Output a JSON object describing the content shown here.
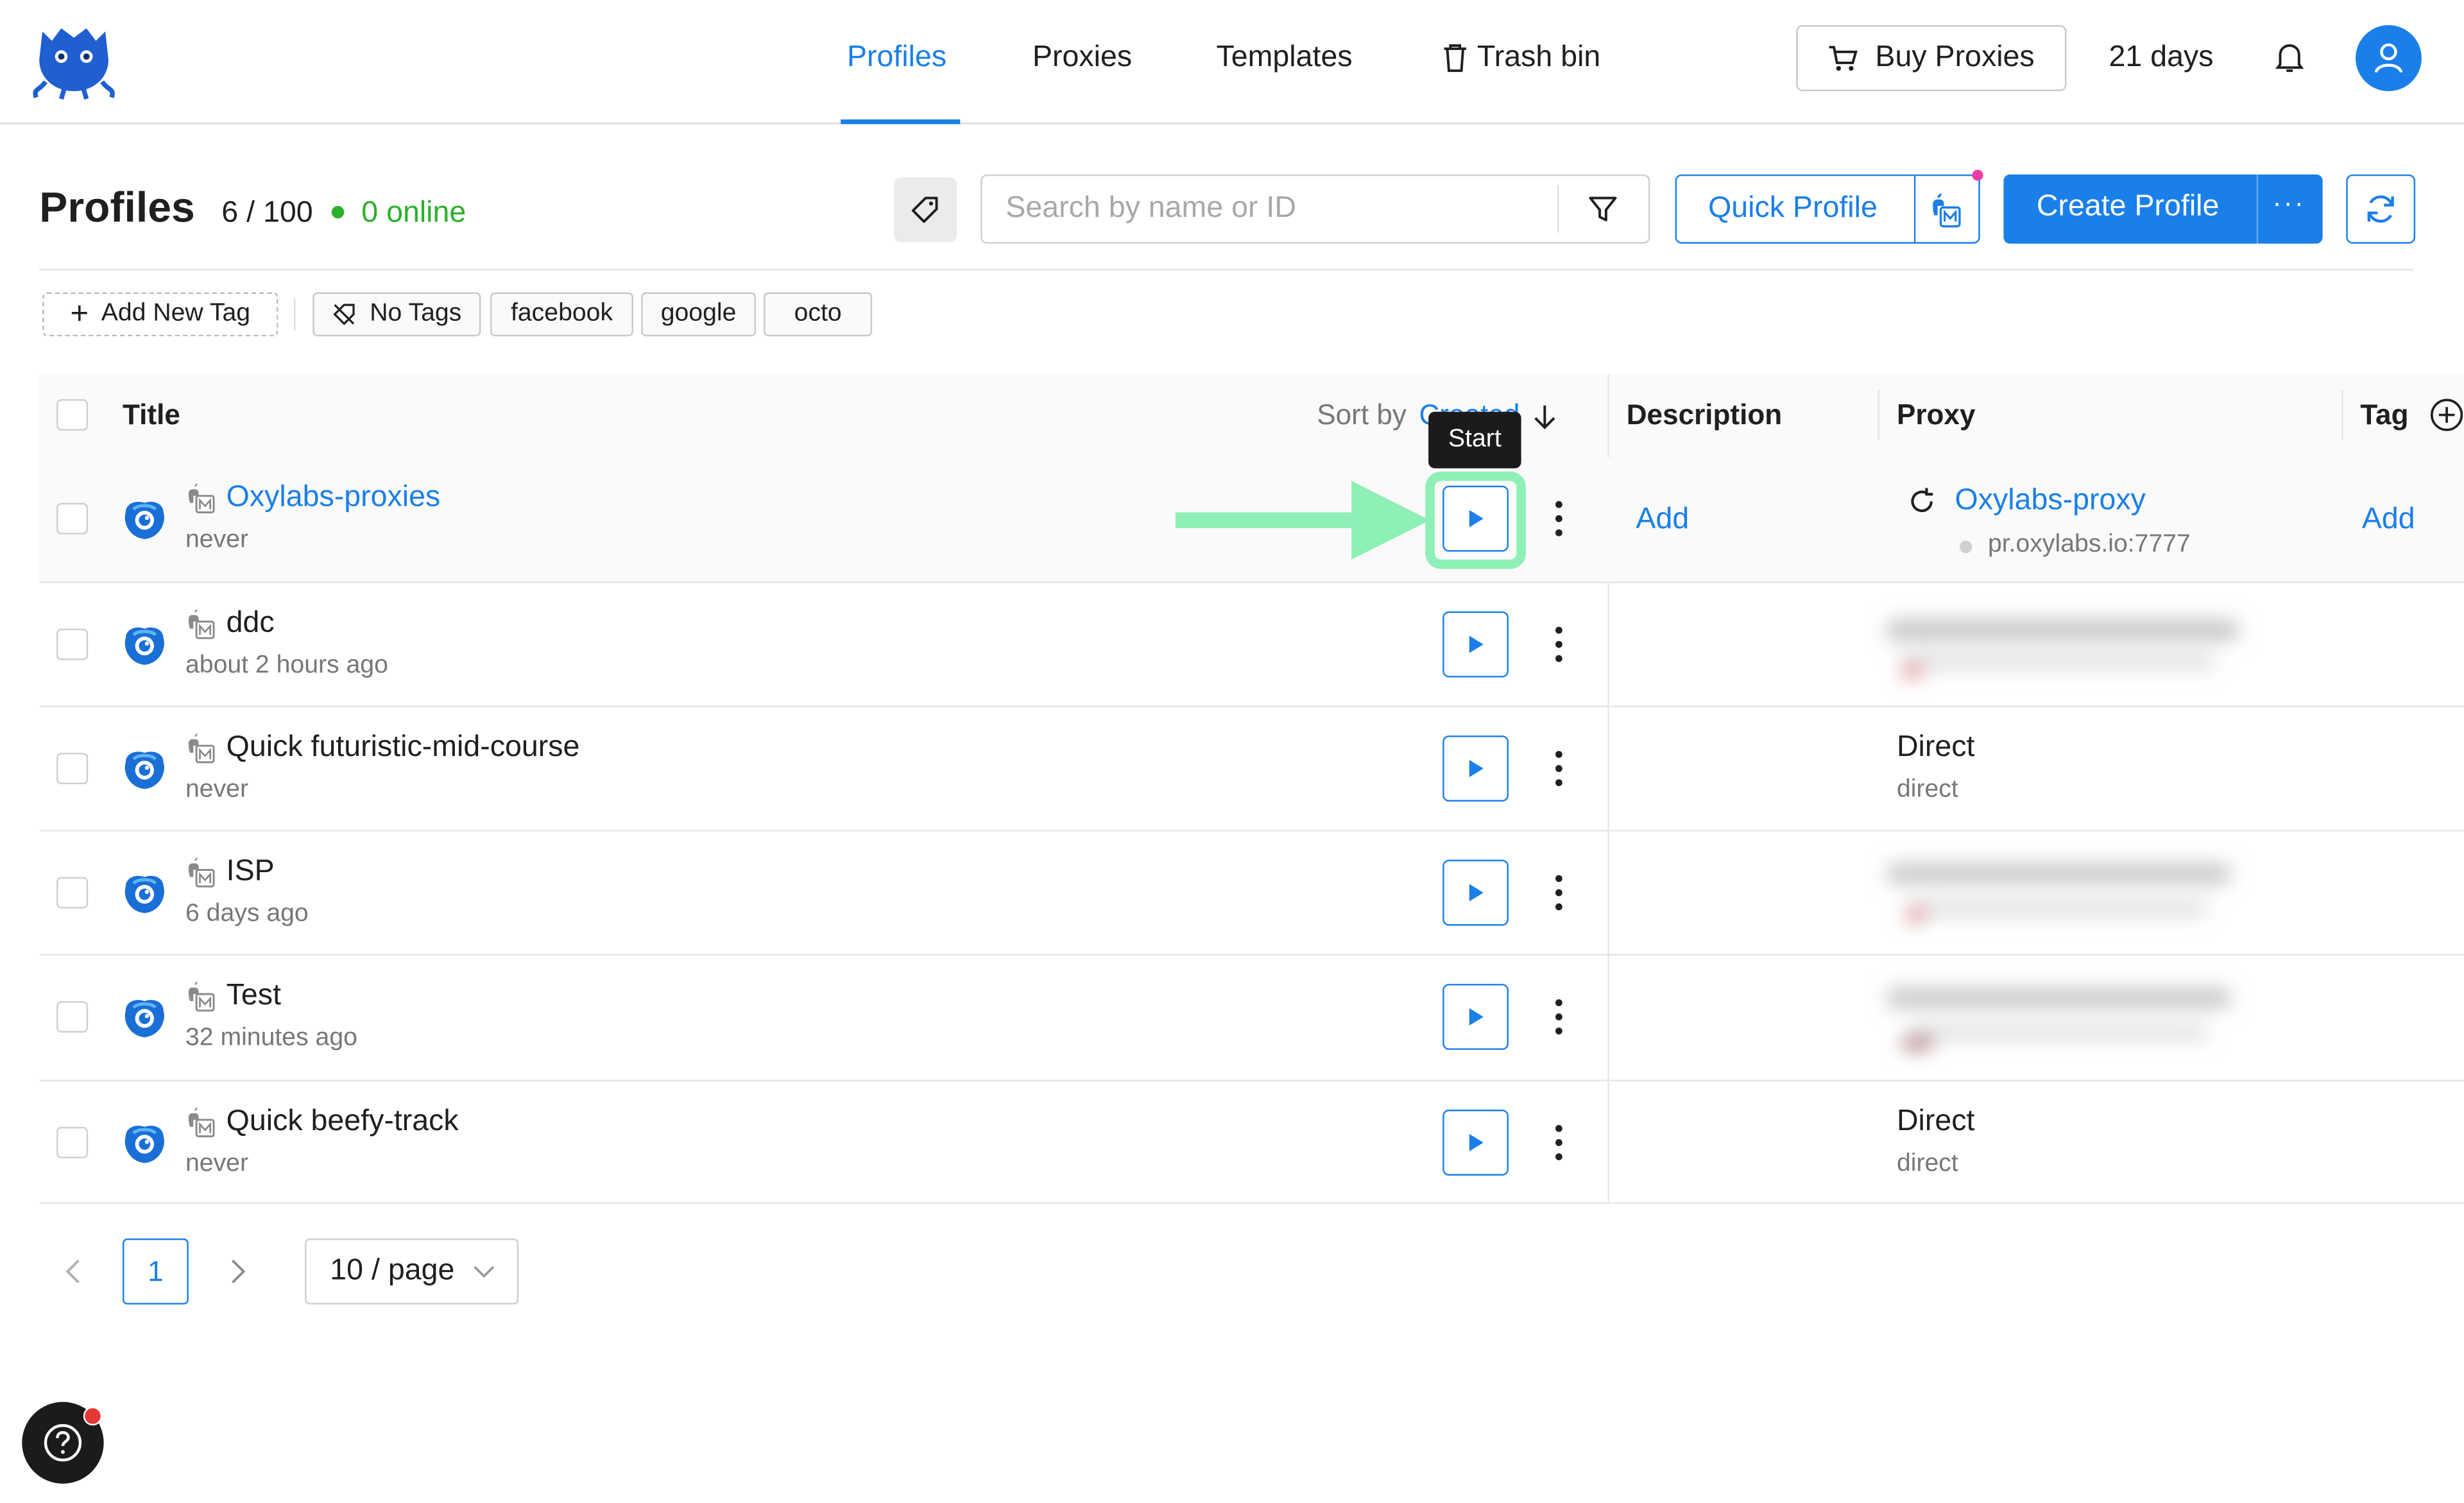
{
  "nav": {
    "links": [
      "Profiles",
      "Proxies",
      "Templates",
      "Trash bin"
    ],
    "buy_label": "Buy Proxies",
    "days_left": "21 days"
  },
  "header": {
    "title": "Profiles",
    "count": "6 / 100",
    "online": "0 online",
    "search_placeholder": "Search by name or ID",
    "quick_profile": "Quick Profile",
    "create_profile": "Create Profile",
    "more": "···"
  },
  "tags": {
    "add_label": "Add New Tag",
    "no_tags": "No Tags",
    "items": [
      "facebook",
      "google",
      "octo"
    ]
  },
  "table": {
    "col_title": "Title",
    "sort_prefix": "Sort by",
    "sort_field": "Created",
    "col_description": "Description",
    "col_proxy": "Proxy",
    "col_tags": "Tag",
    "tooltip": "Start",
    "rows": [
      {
        "title": "Oxylabs-proxies",
        "sub": "never",
        "description": "Add",
        "proxy_name": "Oxylabs-proxy",
        "proxy_addr": "pr.oxylabs.io:7777",
        "tags": "Add"
      },
      {
        "title": "ddc",
        "sub": "about 2 hours ago"
      },
      {
        "title": "Quick futuristic-mid-course",
        "sub": "never",
        "proxy_name": "Direct",
        "proxy_addr": "direct"
      },
      {
        "title": "ISP",
        "sub": "6 days ago"
      },
      {
        "title": "Test",
        "sub": "32 minutes ago"
      },
      {
        "title": "Quick beefy-track",
        "sub": "never",
        "proxy_name": "Direct",
        "proxy_addr": "direct"
      }
    ]
  },
  "pagination": {
    "current": "1",
    "page_size": "10 / page"
  },
  "colors": {
    "accent": "#1a7fe8",
    "online": "#2bb02b",
    "highlight": "#8ef0b6"
  }
}
